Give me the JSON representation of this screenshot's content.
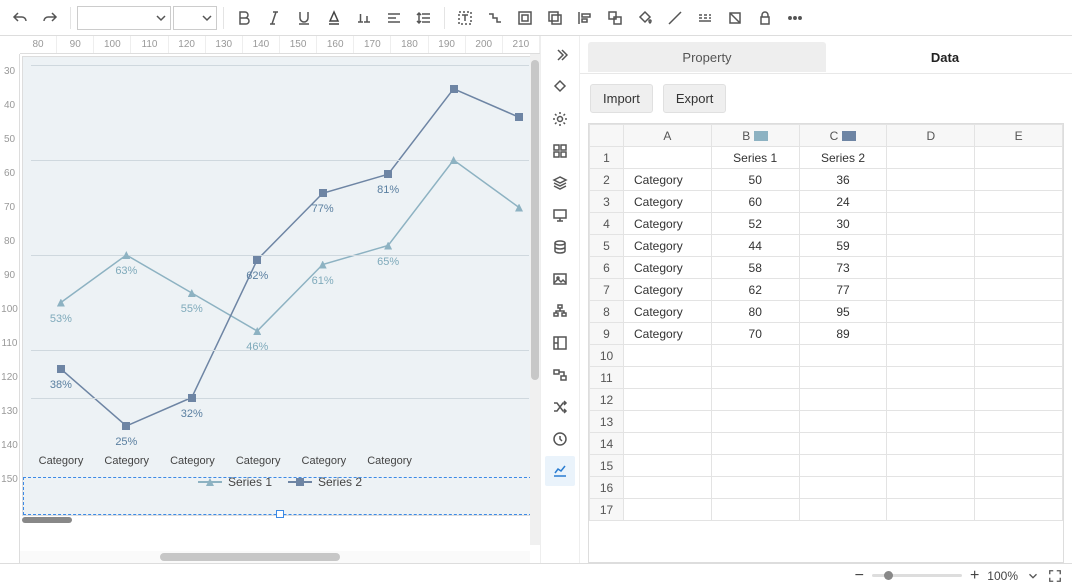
{
  "toolbar": {
    "font": "",
    "size": ""
  },
  "ruler": {
    "h": [
      "80",
      "90",
      "100",
      "110",
      "120",
      "130",
      "140",
      "150",
      "160",
      "170",
      "180",
      "190",
      "200",
      "210"
    ],
    "v": [
      "30",
      "40",
      "50",
      "60",
      "70",
      "80",
      "90",
      "100",
      "110",
      "120",
      "130",
      "140",
      "150"
    ]
  },
  "chart_data": {
    "type": "line",
    "categories": [
      "Category",
      "Category",
      "Category",
      "Category",
      "Category",
      "Category",
      "Category",
      "Category"
    ],
    "series": [
      {
        "name": "Series 1",
        "values": [
          50,
          60,
          52,
          44,
          58,
          62,
          80,
          70
        ],
        "labels": [
          "53%",
          "63%",
          "55%",
          "46%",
          "61%",
          "65%",
          "",
          ""
        ],
        "color": "#8db2c2"
      },
      {
        "name": "Series 2",
        "values": [
          36,
          24,
          30,
          59,
          73,
          77,
          95,
          89
        ],
        "labels": [
          "38%",
          "25%",
          "32%",
          "62%",
          "77%",
          "81%",
          "",
          ""
        ],
        "color": "#6e85a4"
      }
    ],
    "ylim": [
      20,
      100
    ],
    "xlabel": "",
    "ylabel": ""
  },
  "tabs": {
    "property": "Property",
    "data": "Data"
  },
  "actions": {
    "import": "Import",
    "export": "Export"
  },
  "sheet": {
    "cols": [
      "A",
      "B",
      "C",
      "D",
      "E"
    ],
    "header_row": [
      "",
      "Series 1",
      "Series 2",
      "",
      ""
    ],
    "rows": [
      [
        "Category",
        "50",
        "36",
        "",
        ""
      ],
      [
        "Category",
        "60",
        "24",
        "",
        ""
      ],
      [
        "Category",
        "52",
        "30",
        "",
        ""
      ],
      [
        "Category",
        "44",
        "59",
        "",
        ""
      ],
      [
        "Category",
        "58",
        "73",
        "",
        ""
      ],
      [
        "Category",
        "62",
        "77",
        "",
        ""
      ],
      [
        "Category",
        "80",
        "95",
        "",
        ""
      ],
      [
        "Category",
        "70",
        "89",
        "",
        ""
      ]
    ],
    "empty_rows": 8
  },
  "status": {
    "zoom": "100%"
  }
}
